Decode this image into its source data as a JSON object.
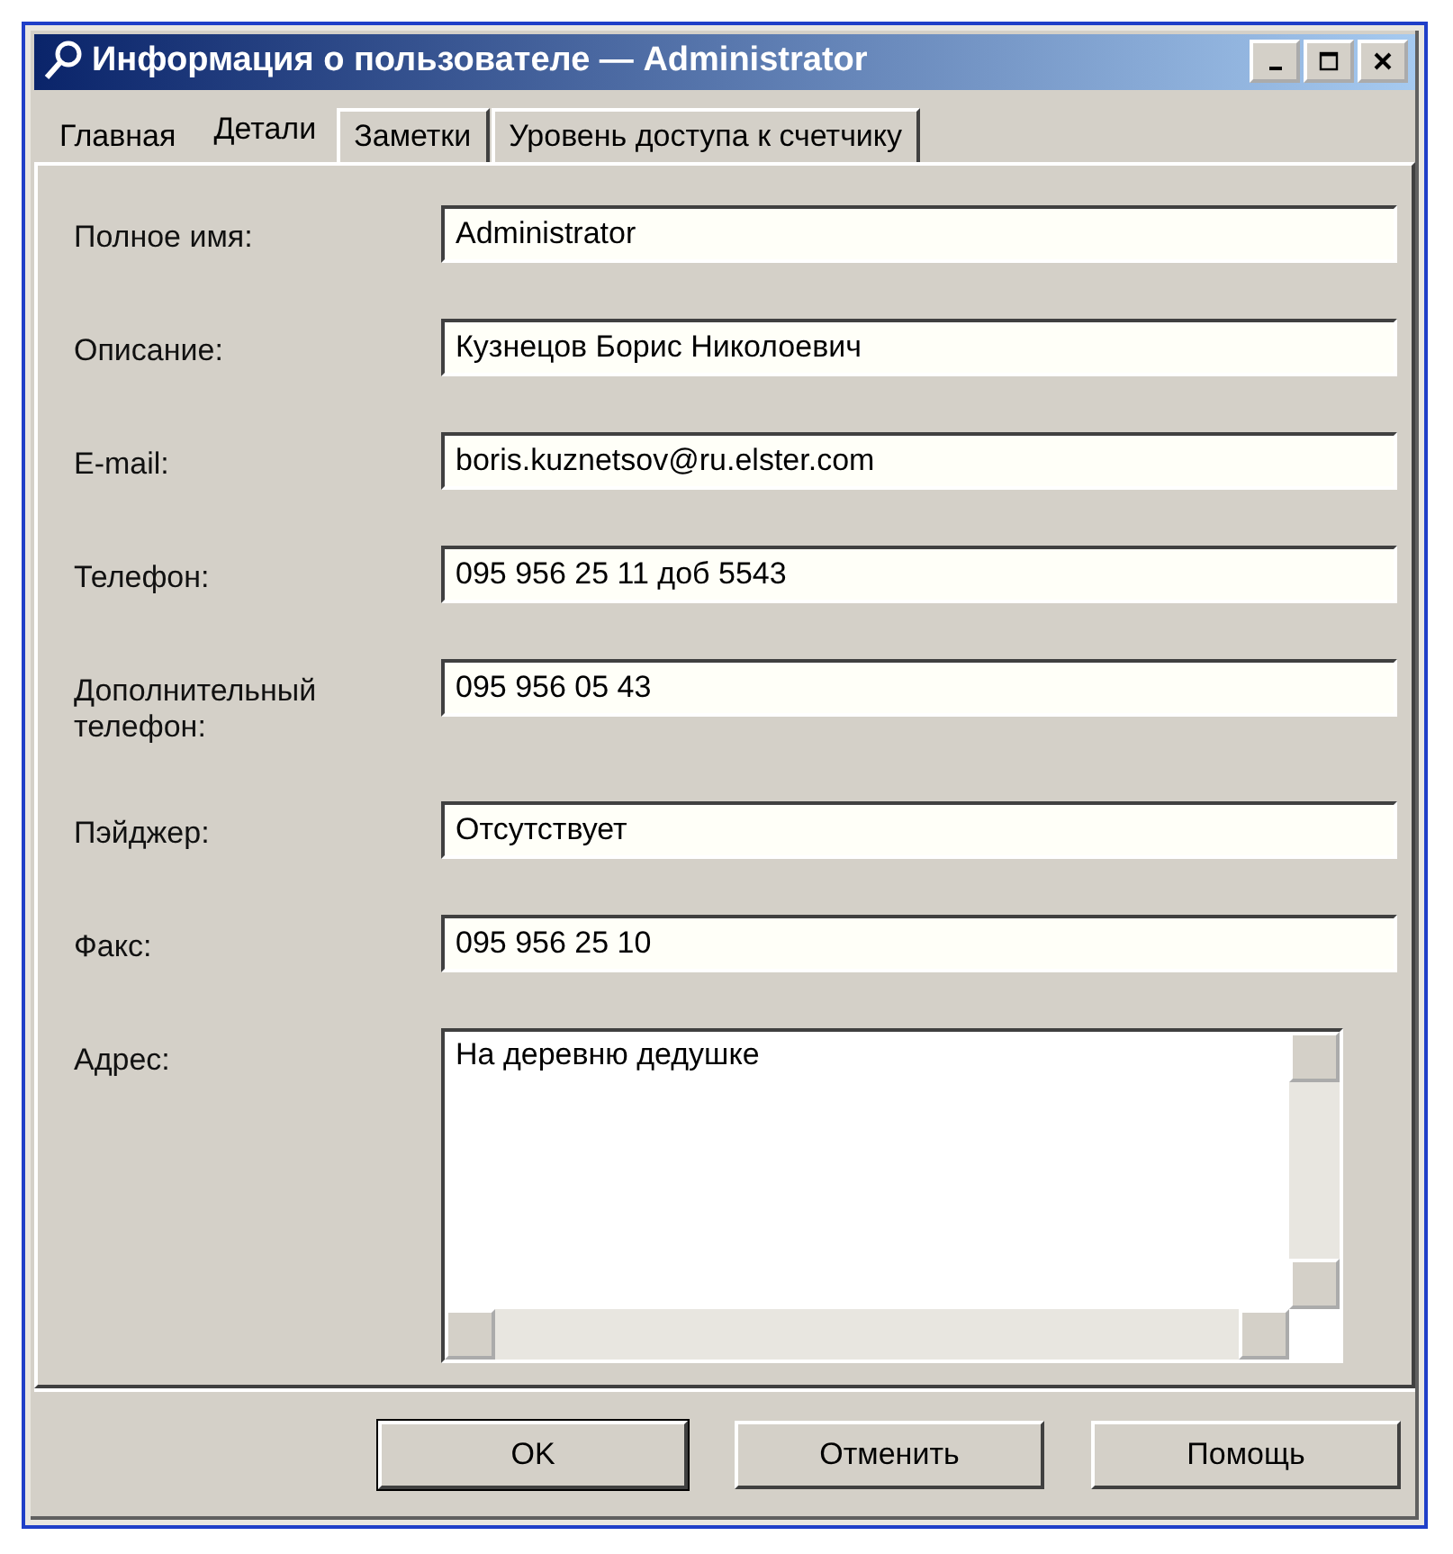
{
  "window": {
    "title": "Информация о пользователе — Administrator"
  },
  "tabs": [
    {
      "label": "Главная",
      "selected": false
    },
    {
      "label": "Детали",
      "selected": true
    },
    {
      "label": "Заметки",
      "selected": false
    },
    {
      "label": "Уровень доступа к счетчику",
      "selected": false
    }
  ],
  "fields": [
    {
      "label": "Полное имя:",
      "value": "Administrator"
    },
    {
      "label": "Описание:",
      "value": "Кузнецов Борис Николоевич"
    },
    {
      "label": "E-mail:",
      "value": "boris.kuznetsov@ru.elster.com"
    },
    {
      "label": "Телефон:",
      "value": "095 956 25 11 доб 5543"
    },
    {
      "label": "Дополнительный телефон:",
      "value": "095 956 05 43"
    },
    {
      "label": "Пэйджер:",
      "value": "Отсутствует"
    },
    {
      "label": "Факс:",
      "value": "095 956 25 10"
    }
  ],
  "address": {
    "label": "Адрес:",
    "value": "На деревню дедушке"
  },
  "buttons": [
    {
      "label": "OK",
      "default": true
    },
    {
      "label": "Отменить",
      "default": false
    },
    {
      "label": "Помощь",
      "default": false
    }
  ]
}
